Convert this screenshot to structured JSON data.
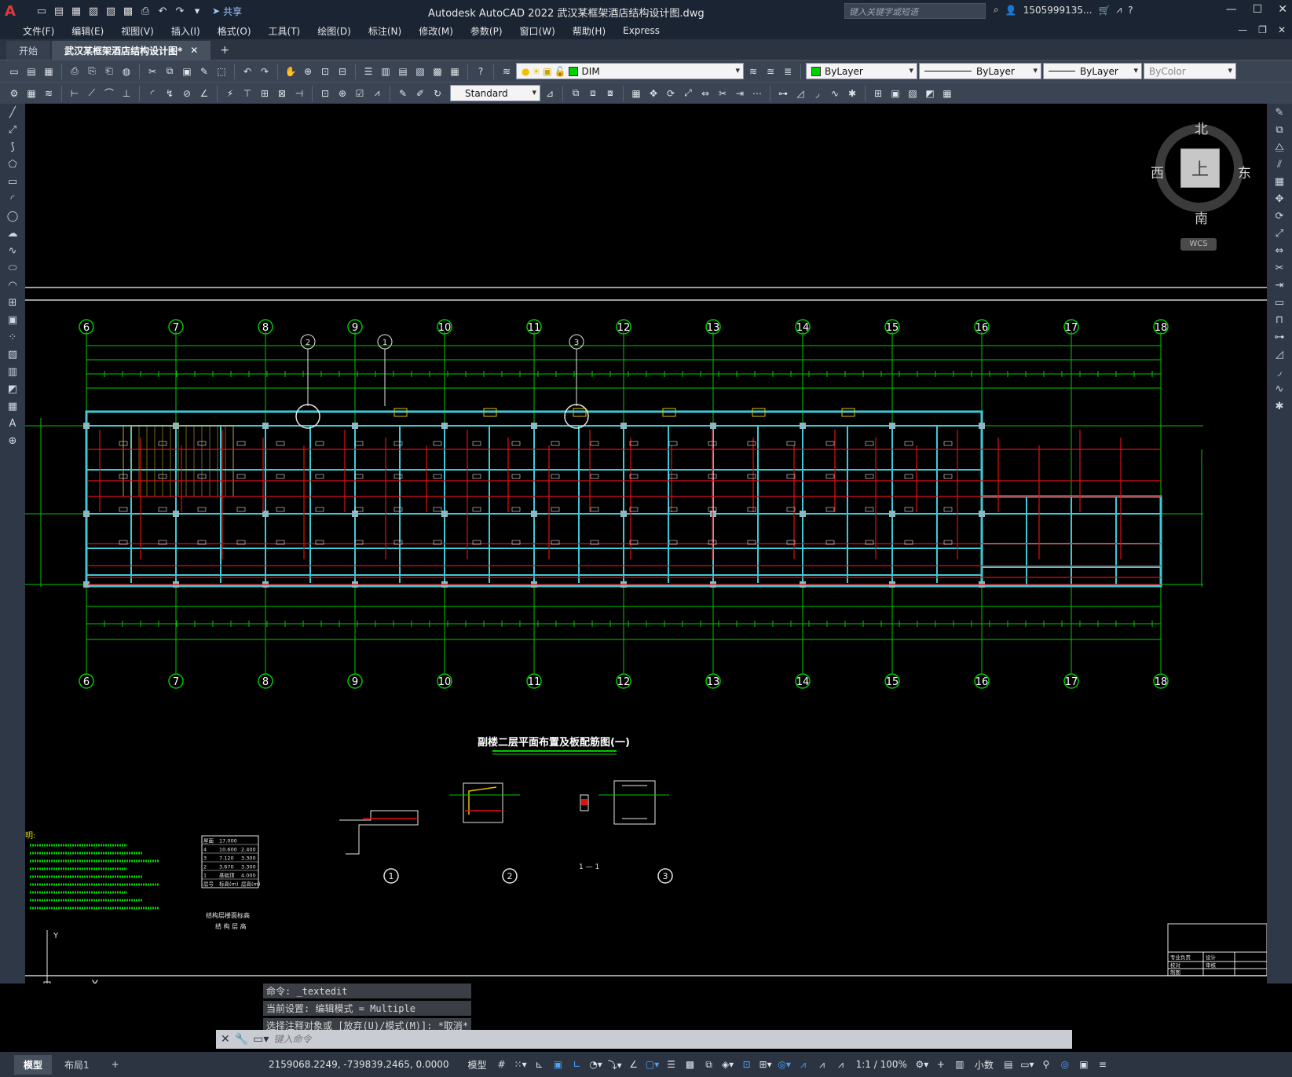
{
  "app": {
    "logo": "A",
    "title": "Autodesk AutoCAD 2022    武汉某框架酒店结构设计图.dwg",
    "share_label": "共享",
    "search_placeholder": "键入关键字或短语",
    "user": "1505999135..."
  },
  "menu": [
    "文件(F)",
    "编辑(E)",
    "视图(V)",
    "插入(I)",
    "格式(O)",
    "工具(T)",
    "绘图(D)",
    "标注(N)",
    "修改(M)",
    "参数(P)",
    "窗口(W)",
    "帮助(H)",
    "Express"
  ],
  "file_tabs": [
    {
      "label": "开始",
      "active": false
    },
    {
      "label": "武汉某框架酒店结构设计图*",
      "active": true
    }
  ],
  "layer_combo": "DIM",
  "color_combo": "ByLayer",
  "linetype_combo": "ByLayer",
  "lineweight_combo": "ByLayer",
  "plotstyle_combo": "ByColor",
  "textstyle_combo": "Standard",
  "colors": {
    "layer_swatch": "#00d000",
    "grid": "#00c800",
    "beam": "#3ec9d6",
    "rebar": "#e01010"
  },
  "viewcube": {
    "north": "北",
    "south": "南",
    "east": "东",
    "west": "西",
    "face": "上",
    "wcs": "WCS"
  },
  "drawing": {
    "axis_labels": [
      "6",
      "7",
      "8",
      "9",
      "10",
      "11",
      "12",
      "13",
      "14",
      "15",
      "16",
      "17",
      "18"
    ],
    "section_marks": [
      "2",
      "1",
      "3"
    ],
    "title": "副楼二层平面布置及板配筋图(一)",
    "detail_marks": [
      "1",
      "2",
      "3"
    ],
    "section_label": "1 — 1",
    "notes_heading": "明:",
    "elevation_table": {
      "rows": [
        [
          "屋面",
          "17.000",
          ""
        ],
        [
          "4",
          "10.600",
          "2.400"
        ],
        [
          "3",
          "7.120",
          "3.300"
        ],
        [
          "2",
          "3.670",
          "3.300"
        ],
        [
          "1",
          "基础顶",
          "4.000"
        ],
        [
          "层号",
          "标高(m)",
          "层高(m)"
        ]
      ],
      "caption1": "结构层楼面标高",
      "caption2": "结 构 层 高"
    },
    "titleblock": [
      "专业负责",
      "设计",
      "校对",
      "审核",
      "制图"
    ]
  },
  "command": {
    "history": [
      "命令: _textedit",
      "当前设置: 编辑模式 = Multiple",
      "选择注释对象或 [放弃(U)/模式(M)]: *取消*"
    ],
    "placeholder": "键入命令"
  },
  "layout_tabs": [
    {
      "label": "模型",
      "active": true
    },
    {
      "label": "布局1",
      "active": false
    }
  ],
  "status": {
    "coordinates": "2159068.2249, -739839.2465, 0.0000",
    "model_label": "模型",
    "scale": "1:1 / 100%",
    "units": "小数"
  }
}
